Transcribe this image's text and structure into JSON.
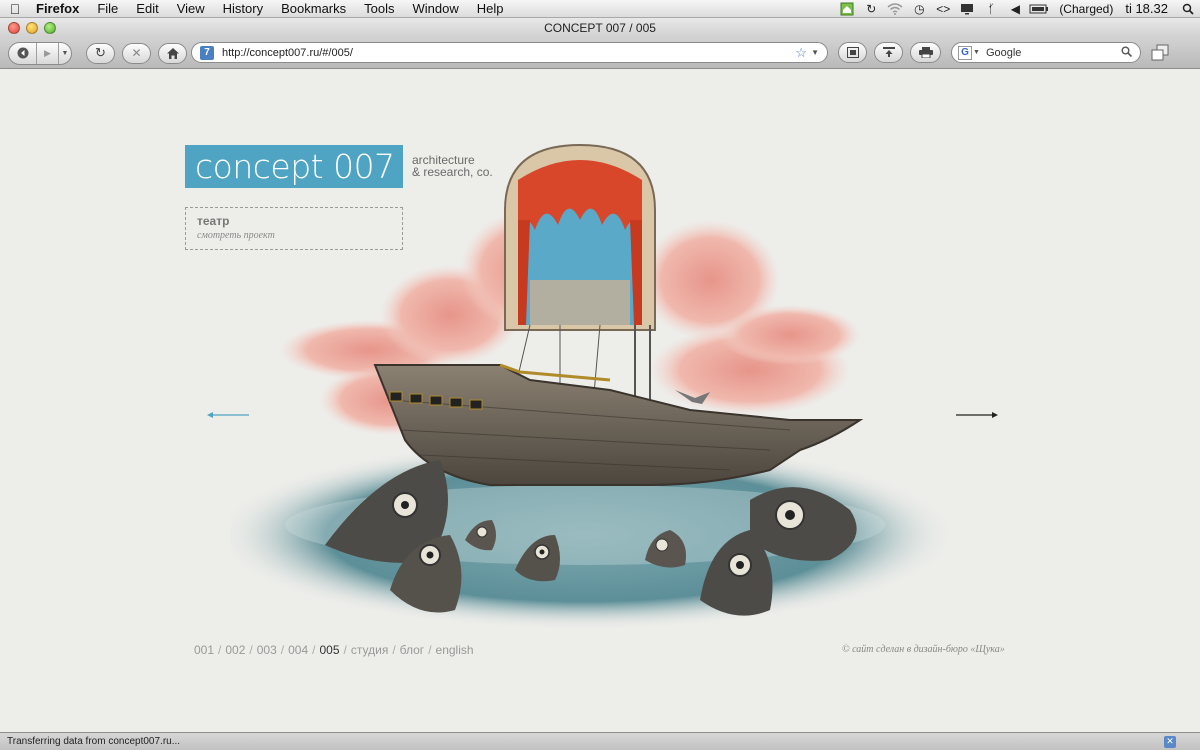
{
  "menubar": {
    "app_name": "Firefox",
    "menus": [
      "File",
      "Edit",
      "View",
      "History",
      "Bookmarks",
      "Tools",
      "Window",
      "Help"
    ],
    "battery_status": "(Charged)",
    "clock": "ti 18.32"
  },
  "window": {
    "title": "CONCEPT 007 / 005"
  },
  "toolbar": {
    "url": "http://concept007.ru/#/005/",
    "search_placeholder": "Google"
  },
  "site": {
    "logo_text": "concept 007",
    "tagline_line1": "architecture",
    "tagline_line2": "& research, co.",
    "project_title": "театр",
    "project_link": "смотреть проект",
    "nav": [
      {
        "label": "001",
        "active": false
      },
      {
        "label": "002",
        "active": false
      },
      {
        "label": "003",
        "active": false
      },
      {
        "label": "004",
        "active": false
      },
      {
        "label": "005",
        "active": true
      },
      {
        "label": "студия",
        "active": false
      },
      {
        "label": "блог",
        "active": false
      },
      {
        "label": "english",
        "active": false
      }
    ],
    "credit": "© сайт сделан в дизайн-бюро «Щука»"
  },
  "statusbar": {
    "text": "Transferring data from concept007.ru..."
  },
  "colors": {
    "accent_blue": "#4fa4c4",
    "curtain_red": "#d9472a",
    "cloud_pink": "#e8a093",
    "water_teal": "#5d9aa5"
  }
}
